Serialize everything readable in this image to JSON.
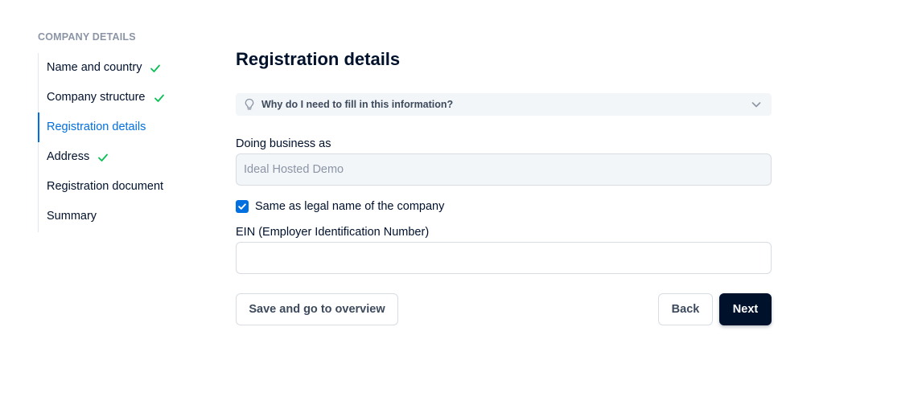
{
  "sidebar": {
    "heading": "COMPANY DETAILS",
    "steps": [
      {
        "label": "Name and country",
        "status": "completed"
      },
      {
        "label": "Company structure",
        "status": "completed"
      },
      {
        "label": "Registration details",
        "status": "active"
      },
      {
        "label": "Address",
        "status": "completed"
      },
      {
        "label": "Registration document",
        "status": "pending"
      },
      {
        "label": "Summary",
        "status": "pending"
      }
    ]
  },
  "main": {
    "title": "Registration details",
    "info_accordion": {
      "label": "Why do I need to fill in this information?",
      "icon": "lightbulb-icon",
      "expanded": false
    },
    "doing_business_as": {
      "label": "Doing business as",
      "value": "Ideal Hosted Demo",
      "disabled": true
    },
    "same_as_legal_name": {
      "label": "Same as legal name of the company",
      "checked": true
    },
    "ein": {
      "label": "EIN (Employer Identification Number)",
      "value": "",
      "placeholder": ""
    },
    "buttons": {
      "save": "Save and go to overview",
      "back": "Back",
      "next": "Next"
    }
  },
  "colors": {
    "accent": "#0070e0",
    "check_green": "#0abf53",
    "primary_dark": "#00112c",
    "muted": "#8c95a5"
  }
}
